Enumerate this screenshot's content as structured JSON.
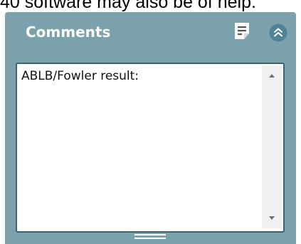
{
  "intro_text": "40 software may also be of help.",
  "panel": {
    "title": "Comments",
    "notes_icon": "notes-icon",
    "collapse_icon": "double-chevron-up-icon",
    "comment_value": "ABLB/Fowler result:",
    "scroll_up_icon": "triangle-up-icon",
    "scroll_down_icon": "triangle-down-icon",
    "resize_icon": "resize-grip-icon"
  },
  "colors": {
    "panel_bg": "#7ba2ac",
    "panel_title": "#ffffff",
    "button_circle": "#4f8294",
    "textarea_border": "#3b6472",
    "scrollbar_bg": "#f0f0f0"
  }
}
